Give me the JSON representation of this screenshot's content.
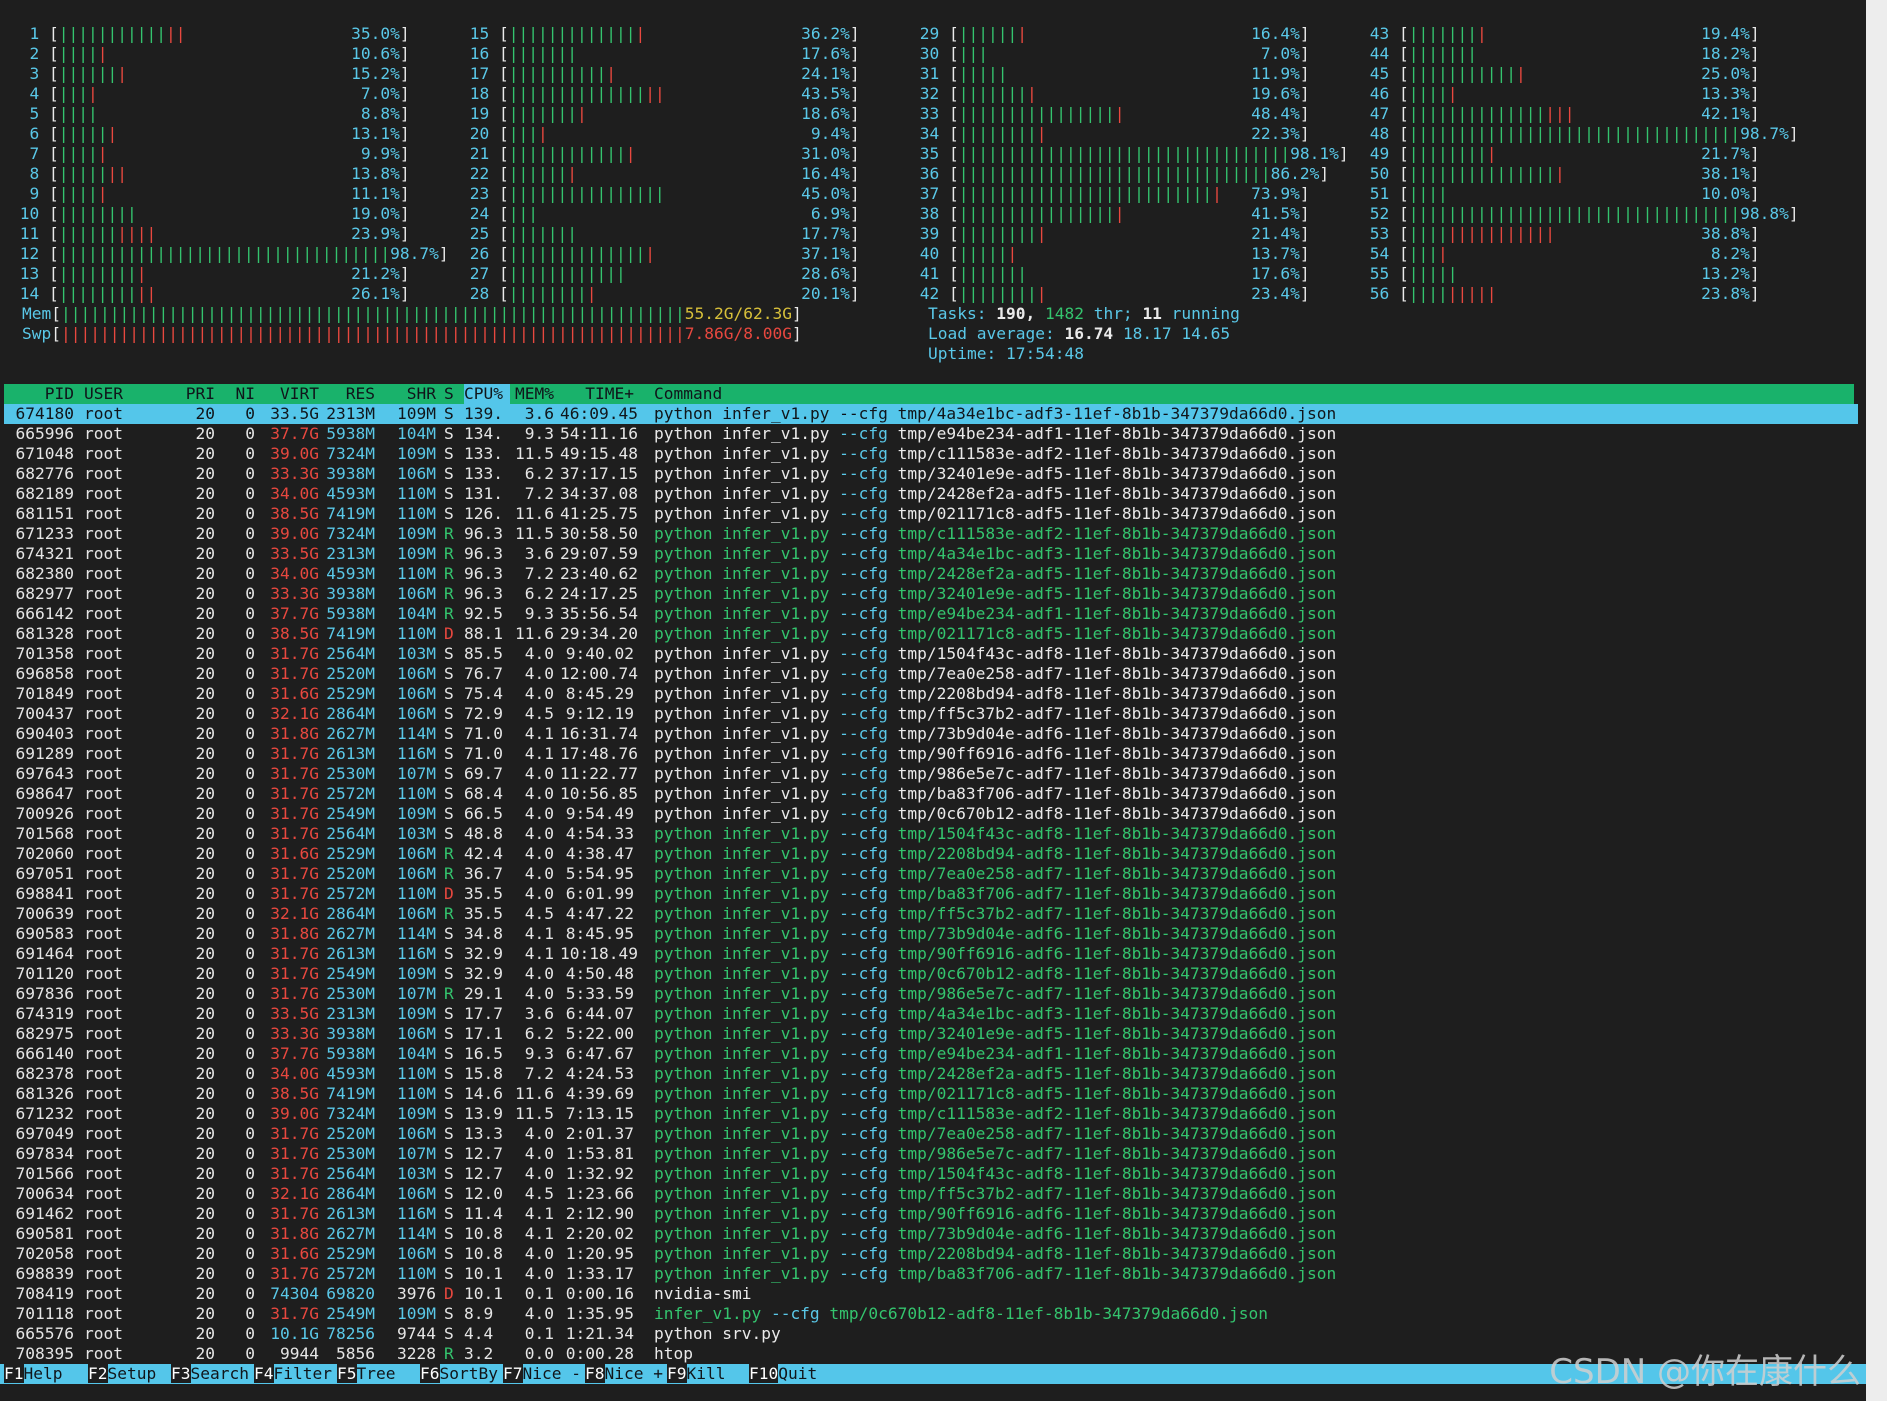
{
  "cpus": [
    {
      "id": "1",
      "pct": "35.0%",
      "g": 11,
      "r": 2
    },
    {
      "id": "2",
      "pct": "10.6%",
      "g": 4,
      "r": 1
    },
    {
      "id": "3",
      "pct": "15.2%",
      "g": 6,
      "r": 1
    },
    {
      "id": "4",
      "pct": "7.0%",
      "g": 3,
      "r": 1
    },
    {
      "id": "5",
      "pct": "8.8%",
      "g": 4,
      "r": 0
    },
    {
      "id": "6",
      "pct": "13.1%",
      "g": 5,
      "r": 1
    },
    {
      "id": "7",
      "pct": "9.9%",
      "g": 4,
      "r": 1
    },
    {
      "id": "8",
      "pct": "13.8%",
      "g": 5,
      "r": 2
    },
    {
      "id": "9",
      "pct": "11.1%",
      "g": 4,
      "r": 1
    },
    {
      "id": "10",
      "pct": "19.0%",
      "g": 8,
      "r": 0
    },
    {
      "id": "11",
      "pct": "23.9%",
      "g": 6,
      "r": 4
    },
    {
      "id": "12",
      "pct": "98.7%",
      "g": 34,
      "r": 0
    },
    {
      "id": "13",
      "pct": "21.2%",
      "g": 8,
      "r": 1
    },
    {
      "id": "14",
      "pct": "26.1%",
      "g": 8,
      "r": 2
    },
    {
      "id": "15",
      "pct": "36.2%",
      "g": 13,
      "r": 1
    },
    {
      "id": "16",
      "pct": "17.6%",
      "g": 7,
      "r": 0
    },
    {
      "id": "17",
      "pct": "24.1%",
      "g": 10,
      "r": 1
    },
    {
      "id": "18",
      "pct": "43.5%",
      "g": 14,
      "r": 2
    },
    {
      "id": "19",
      "pct": "18.6%",
      "g": 7,
      "r": 1
    },
    {
      "id": "20",
      "pct": "9.4%",
      "g": 3,
      "r": 1
    },
    {
      "id": "21",
      "pct": "31.0%",
      "g": 12,
      "r": 1
    },
    {
      "id": "22",
      "pct": "16.4%",
      "g": 6,
      "r": 1
    },
    {
      "id": "23",
      "pct": "45.0%",
      "g": 16,
      "r": 0
    },
    {
      "id": "24",
      "pct": "6.9%",
      "g": 3,
      "r": 0
    },
    {
      "id": "25",
      "pct": "17.7%",
      "g": 7,
      "r": 0
    },
    {
      "id": "26",
      "pct": "37.1%",
      "g": 14,
      "r": 1
    },
    {
      "id": "27",
      "pct": "28.6%",
      "g": 12,
      "r": 0
    },
    {
      "id": "28",
      "pct": "20.1%",
      "g": 8,
      "r": 1
    },
    {
      "id": "29",
      "pct": "16.4%",
      "g": 6,
      "r": 1
    },
    {
      "id": "30",
      "pct": "7.0%",
      "g": 3,
      "r": 0
    },
    {
      "id": "31",
      "pct": "11.9%",
      "g": 5,
      "r": 0
    },
    {
      "id": "32",
      "pct": "19.6%",
      "g": 7,
      "r": 1
    },
    {
      "id": "33",
      "pct": "48.4%",
      "g": 16,
      "r": 1
    },
    {
      "id": "34",
      "pct": "22.3%",
      "g": 8,
      "r": 1
    },
    {
      "id": "35",
      "pct": "98.1%",
      "g": 34,
      "r": 0
    },
    {
      "id": "36",
      "pct": "86.2%",
      "g": 32,
      "r": 0
    },
    {
      "id": "37",
      "pct": "73.9%",
      "g": 26,
      "r": 1
    },
    {
      "id": "38",
      "pct": "41.5%",
      "g": 16,
      "r": 1
    },
    {
      "id": "39",
      "pct": "21.4%",
      "g": 8,
      "r": 1
    },
    {
      "id": "40",
      "pct": "13.7%",
      "g": 5,
      "r": 1
    },
    {
      "id": "41",
      "pct": "17.6%",
      "g": 7,
      "r": 0
    },
    {
      "id": "42",
      "pct": "23.4%",
      "g": 8,
      "r": 1
    },
    {
      "id": "43",
      "pct": "19.4%",
      "g": 7,
      "r": 1
    },
    {
      "id": "44",
      "pct": "18.2%",
      "g": 7,
      "r": 0
    },
    {
      "id": "45",
      "pct": "25.0%",
      "g": 11,
      "r": 1
    },
    {
      "id": "46",
      "pct": "13.3%",
      "g": 4,
      "r": 1
    },
    {
      "id": "47",
      "pct": "42.1%",
      "g": 14,
      "r": 3
    },
    {
      "id": "48",
      "pct": "98.7%",
      "g": 34,
      "r": 0
    },
    {
      "id": "49",
      "pct": "21.7%",
      "g": 8,
      "r": 1
    },
    {
      "id": "50",
      "pct": "38.1%",
      "g": 15,
      "r": 1
    },
    {
      "id": "51",
      "pct": "10.0%",
      "g": 4,
      "r": 0
    },
    {
      "id": "52",
      "pct": "98.8%",
      "g": 34,
      "r": 0
    },
    {
      "id": "53",
      "pct": "38.8%",
      "g": 4,
      "r": 11
    },
    {
      "id": "54",
      "pct": "8.2%",
      "g": 3,
      "r": 1
    },
    {
      "id": "55",
      "pct": "13.2%",
      "g": 5,
      "r": 0
    },
    {
      "id": "56",
      "pct": "23.8%",
      "g": 4,
      "r": 5
    }
  ],
  "mem": {
    "label": "Mem",
    "value": "55.2G/62.3G"
  },
  "swp": {
    "label": "Swp",
    "value": "7.86G/8.00G"
  },
  "tasks": {
    "label": "Tasks:",
    "count": "190,",
    "thr": "1482",
    "thr_label": "thr;",
    "running": "11",
    "running_label": "running"
  },
  "load": {
    "label": "Load average:",
    "l1": "16.74",
    "l5": "18.17",
    "l15": "14.65"
  },
  "uptime": {
    "label": "Uptime:",
    "value": "17:54:48"
  },
  "columns": [
    "PID",
    "USER",
    "PRI",
    "NI",
    "VIRT",
    "RES",
    "SHR",
    "S",
    "CPU%",
    "MEM%",
    "TIME+",
    "Command"
  ],
  "processes": [
    [
      "674180",
      "root",
      "20",
      "0",
      "33.5G",
      "2313M",
      "109M",
      "S",
      "139.",
      "3.6",
      "46:09.45",
      "python",
      "infer_v1.py",
      "--cfg",
      "tmp/4a34e1bc-adf3-11ef-8b1b-347379da66d0.json",
      "w"
    ],
    [
      "665996",
      "root",
      "20",
      "0",
      "37.7G",
      "5938M",
      "104M",
      "S",
      "134.",
      "9.3",
      "54:11.16",
      "python",
      "infer_v1.py",
      "--cfg",
      "tmp/e94be234-adf1-11ef-8b1b-347379da66d0.json",
      "w"
    ],
    [
      "671048",
      "root",
      "20",
      "0",
      "39.0G",
      "7324M",
      "109M",
      "S",
      "133.",
      "11.5",
      "49:15.48",
      "python",
      "infer_v1.py",
      "--cfg",
      "tmp/c111583e-adf2-11ef-8b1b-347379da66d0.json",
      "w"
    ],
    [
      "682776",
      "root",
      "20",
      "0",
      "33.3G",
      "3938M",
      "106M",
      "S",
      "133.",
      "6.2",
      "37:17.15",
      "python",
      "infer_v1.py",
      "--cfg",
      "tmp/32401e9e-adf5-11ef-8b1b-347379da66d0.json",
      "w"
    ],
    [
      "682189",
      "root",
      "20",
      "0",
      "34.0G",
      "4593M",
      "110M",
      "S",
      "131.",
      "7.2",
      "34:37.08",
      "python",
      "infer_v1.py",
      "--cfg",
      "tmp/2428ef2a-adf5-11ef-8b1b-347379da66d0.json",
      "w"
    ],
    [
      "681151",
      "root",
      "20",
      "0",
      "38.5G",
      "7419M",
      "110M",
      "S",
      "126.",
      "11.6",
      "41:25.75",
      "python",
      "infer_v1.py",
      "--cfg",
      "tmp/021171c8-adf5-11ef-8b1b-347379da66d0.json",
      "w"
    ],
    [
      "671233",
      "root",
      "20",
      "0",
      "39.0G",
      "7324M",
      "109M",
      "R",
      "96.3",
      "11.5",
      "30:58.50",
      "python",
      "infer_v1.py",
      "--cfg",
      "tmp/c111583e-adf2-11ef-8b1b-347379da66d0.json",
      "g"
    ],
    [
      "674321",
      "root",
      "20",
      "0",
      "33.5G",
      "2313M",
      "109M",
      "R",
      "96.3",
      "3.6",
      "29:07.59",
      "python",
      "infer_v1.py",
      "--cfg",
      "tmp/4a34e1bc-adf3-11ef-8b1b-347379da66d0.json",
      "g"
    ],
    [
      "682380",
      "root",
      "20",
      "0",
      "34.0G",
      "4593M",
      "110M",
      "R",
      "96.3",
      "7.2",
      "23:40.62",
      "python",
      "infer_v1.py",
      "--cfg",
      "tmp/2428ef2a-adf5-11ef-8b1b-347379da66d0.json",
      "g"
    ],
    [
      "682977",
      "root",
      "20",
      "0",
      "33.3G",
      "3938M",
      "106M",
      "R",
      "96.3",
      "6.2",
      "24:17.25",
      "python",
      "infer_v1.py",
      "--cfg",
      "tmp/32401e9e-adf5-11ef-8b1b-347379da66d0.json",
      "g"
    ],
    [
      "666142",
      "root",
      "20",
      "0",
      "37.7G",
      "5938M",
      "104M",
      "R",
      "92.5",
      "9.3",
      "35:56.54",
      "python",
      "infer_v1.py",
      "--cfg",
      "tmp/e94be234-adf1-11ef-8b1b-347379da66d0.json",
      "g"
    ],
    [
      "681328",
      "root",
      "20",
      "0",
      "38.5G",
      "7419M",
      "110M",
      "D",
      "88.1",
      "11.6",
      "29:34.20",
      "python",
      "infer_v1.py",
      "--cfg",
      "tmp/021171c8-adf5-11ef-8b1b-347379da66d0.json",
      "g"
    ],
    [
      "701358",
      "root",
      "20",
      "0",
      "31.7G",
      "2564M",
      "103M",
      "S",
      "85.5",
      "4.0",
      "9:40.02",
      "python",
      "infer_v1.py",
      "--cfg",
      "tmp/1504f43c-adf8-11ef-8b1b-347379da66d0.json",
      "w"
    ],
    [
      "696858",
      "root",
      "20",
      "0",
      "31.7G",
      "2520M",
      "106M",
      "S",
      "76.7",
      "4.0",
      "12:00.74",
      "python",
      "infer_v1.py",
      "--cfg",
      "tmp/7ea0e258-adf7-11ef-8b1b-347379da66d0.json",
      "w"
    ],
    [
      "701849",
      "root",
      "20",
      "0",
      "31.6G",
      "2529M",
      "106M",
      "S",
      "75.4",
      "4.0",
      "8:45.29",
      "python",
      "infer_v1.py",
      "--cfg",
      "tmp/2208bd94-adf8-11ef-8b1b-347379da66d0.json",
      "w"
    ],
    [
      "700437",
      "root",
      "20",
      "0",
      "32.1G",
      "2864M",
      "106M",
      "S",
      "72.9",
      "4.5",
      "9:12.19",
      "python",
      "infer_v1.py",
      "--cfg",
      "tmp/ff5c37b2-adf7-11ef-8b1b-347379da66d0.json",
      "w"
    ],
    [
      "690403",
      "root",
      "20",
      "0",
      "31.8G",
      "2627M",
      "114M",
      "S",
      "71.0",
      "4.1",
      "16:31.74",
      "python",
      "infer_v1.py",
      "--cfg",
      "tmp/73b9d04e-adf6-11ef-8b1b-347379da66d0.json",
      "w"
    ],
    [
      "691289",
      "root",
      "20",
      "0",
      "31.7G",
      "2613M",
      "116M",
      "S",
      "71.0",
      "4.1",
      "17:48.76",
      "python",
      "infer_v1.py",
      "--cfg",
      "tmp/90ff6916-adf6-11ef-8b1b-347379da66d0.json",
      "w"
    ],
    [
      "697643",
      "root",
      "20",
      "0",
      "31.7G",
      "2530M",
      "107M",
      "S",
      "69.7",
      "4.0",
      "11:22.77",
      "python",
      "infer_v1.py",
      "--cfg",
      "tmp/986e5e7c-adf7-11ef-8b1b-347379da66d0.json",
      "w"
    ],
    [
      "698647",
      "root",
      "20",
      "0",
      "31.7G",
      "2572M",
      "110M",
      "S",
      "68.4",
      "4.0",
      "10:56.85",
      "python",
      "infer_v1.py",
      "--cfg",
      "tmp/ba83f706-adf7-11ef-8b1b-347379da66d0.json",
      "w"
    ],
    [
      "700926",
      "root",
      "20",
      "0",
      "31.7G",
      "2549M",
      "109M",
      "S",
      "66.5",
      "4.0",
      "9:54.49",
      "python",
      "infer_v1.py",
      "--cfg",
      "tmp/0c670b12-adf8-11ef-8b1b-347379da66d0.json",
      "w"
    ],
    [
      "701568",
      "root",
      "20",
      "0",
      "31.7G",
      "2564M",
      "103M",
      "S",
      "48.8",
      "4.0",
      "4:54.33",
      "python",
      "infer_v1.py",
      "--cfg",
      "tmp/1504f43c-adf8-11ef-8b1b-347379da66d0.json",
      "g"
    ],
    [
      "702060",
      "root",
      "20",
      "0",
      "31.6G",
      "2529M",
      "106M",
      "R",
      "42.4",
      "4.0",
      "4:38.47",
      "python",
      "infer_v1.py",
      "--cfg",
      "tmp/2208bd94-adf8-11ef-8b1b-347379da66d0.json",
      "g"
    ],
    [
      "697051",
      "root",
      "20",
      "0",
      "31.7G",
      "2520M",
      "106M",
      "R",
      "36.7",
      "4.0",
      "5:54.95",
      "python",
      "infer_v1.py",
      "--cfg",
      "tmp/7ea0e258-adf7-11ef-8b1b-347379da66d0.json",
      "g"
    ],
    [
      "698841",
      "root",
      "20",
      "0",
      "31.7G",
      "2572M",
      "110M",
      "D",
      "35.5",
      "4.0",
      "6:01.99",
      "python",
      "infer_v1.py",
      "--cfg",
      "tmp/ba83f706-adf7-11ef-8b1b-347379da66d0.json",
      "g"
    ],
    [
      "700639",
      "root",
      "20",
      "0",
      "32.1G",
      "2864M",
      "106M",
      "R",
      "35.5",
      "4.5",
      "4:47.22",
      "python",
      "infer_v1.py",
      "--cfg",
      "tmp/ff5c37b2-adf7-11ef-8b1b-347379da66d0.json",
      "g"
    ],
    [
      "690583",
      "root",
      "20",
      "0",
      "31.8G",
      "2627M",
      "114M",
      "S",
      "34.8",
      "4.1",
      "8:45.95",
      "python",
      "infer_v1.py",
      "--cfg",
      "tmp/73b9d04e-adf6-11ef-8b1b-347379da66d0.json",
      "g"
    ],
    [
      "691464",
      "root",
      "20",
      "0",
      "31.7G",
      "2613M",
      "116M",
      "S",
      "32.9",
      "4.1",
      "10:18.49",
      "python",
      "infer_v1.py",
      "--cfg",
      "tmp/90ff6916-adf6-11ef-8b1b-347379da66d0.json",
      "g"
    ],
    [
      "701120",
      "root",
      "20",
      "0",
      "31.7G",
      "2549M",
      "109M",
      "S",
      "32.9",
      "4.0",
      "4:50.48",
      "python",
      "infer_v1.py",
      "--cfg",
      "tmp/0c670b12-adf8-11ef-8b1b-347379da66d0.json",
      "g"
    ],
    [
      "697836",
      "root",
      "20",
      "0",
      "31.7G",
      "2530M",
      "107M",
      "R",
      "29.1",
      "4.0",
      "5:33.59",
      "python",
      "infer_v1.py",
      "--cfg",
      "tmp/986e5e7c-adf7-11ef-8b1b-347379da66d0.json",
      "g"
    ],
    [
      "674319",
      "root",
      "20",
      "0",
      "33.5G",
      "2313M",
      "109M",
      "S",
      "17.7",
      "3.6",
      "6:44.07",
      "python",
      "infer_v1.py",
      "--cfg",
      "tmp/4a34e1bc-adf3-11ef-8b1b-347379da66d0.json",
      "g"
    ],
    [
      "682975",
      "root",
      "20",
      "0",
      "33.3G",
      "3938M",
      "106M",
      "S",
      "17.1",
      "6.2",
      "5:22.00",
      "python",
      "infer_v1.py",
      "--cfg",
      "tmp/32401e9e-adf5-11ef-8b1b-347379da66d0.json",
      "g"
    ],
    [
      "666140",
      "root",
      "20",
      "0",
      "37.7G",
      "5938M",
      "104M",
      "S",
      "16.5",
      "9.3",
      "6:47.67",
      "python",
      "infer_v1.py",
      "--cfg",
      "tmp/e94be234-adf1-11ef-8b1b-347379da66d0.json",
      "g"
    ],
    [
      "682378",
      "root",
      "20",
      "0",
      "34.0G",
      "4593M",
      "110M",
      "S",
      "15.8",
      "7.2",
      "4:24.53",
      "python",
      "infer_v1.py",
      "--cfg",
      "tmp/2428ef2a-adf5-11ef-8b1b-347379da66d0.json",
      "g"
    ],
    [
      "681326",
      "root",
      "20",
      "0",
      "38.5G",
      "7419M",
      "110M",
      "S",
      "14.6",
      "11.6",
      "4:39.69",
      "python",
      "infer_v1.py",
      "--cfg",
      "tmp/021171c8-adf5-11ef-8b1b-347379da66d0.json",
      "g"
    ],
    [
      "671232",
      "root",
      "20",
      "0",
      "39.0G",
      "7324M",
      "109M",
      "S",
      "13.9",
      "11.5",
      "7:13.15",
      "python",
      "infer_v1.py",
      "--cfg",
      "tmp/c111583e-adf2-11ef-8b1b-347379da66d0.json",
      "g"
    ],
    [
      "697049",
      "root",
      "20",
      "0",
      "31.7G",
      "2520M",
      "106M",
      "S",
      "13.3",
      "4.0",
      "2:01.37",
      "python",
      "infer_v1.py",
      "--cfg",
      "tmp/7ea0e258-adf7-11ef-8b1b-347379da66d0.json",
      "g"
    ],
    [
      "697834",
      "root",
      "20",
      "0",
      "31.7G",
      "2530M",
      "107M",
      "S",
      "12.7",
      "4.0",
      "1:53.81",
      "python",
      "infer_v1.py",
      "--cfg",
      "tmp/986e5e7c-adf7-11ef-8b1b-347379da66d0.json",
      "g"
    ],
    [
      "701566",
      "root",
      "20",
      "0",
      "31.7G",
      "2564M",
      "103M",
      "S",
      "12.7",
      "4.0",
      "1:32.92",
      "python",
      "infer_v1.py",
      "--cfg",
      "tmp/1504f43c-adf8-11ef-8b1b-347379da66d0.json",
      "g"
    ],
    [
      "700634",
      "root",
      "20",
      "0",
      "32.1G",
      "2864M",
      "106M",
      "S",
      "12.0",
      "4.5",
      "1:23.66",
      "python",
      "infer_v1.py",
      "--cfg",
      "tmp/ff5c37b2-adf7-11ef-8b1b-347379da66d0.json",
      "g"
    ],
    [
      "691462",
      "root",
      "20",
      "0",
      "31.7G",
      "2613M",
      "116M",
      "S",
      "11.4",
      "4.1",
      "2:12.90",
      "python",
      "infer_v1.py",
      "--cfg",
      "tmp/90ff6916-adf6-11ef-8b1b-347379da66d0.json",
      "g"
    ],
    [
      "690581",
      "root",
      "20",
      "0",
      "31.8G",
      "2627M",
      "114M",
      "S",
      "10.8",
      "4.1",
      "2:20.02",
      "python",
      "infer_v1.py",
      "--cfg",
      "tmp/73b9d04e-adf6-11ef-8b1b-347379da66d0.json",
      "g"
    ],
    [
      "702058",
      "root",
      "20",
      "0",
      "31.6G",
      "2529M",
      "106M",
      "S",
      "10.8",
      "4.0",
      "1:20.95",
      "python",
      "infer_v1.py",
      "--cfg",
      "tmp/2208bd94-adf8-11ef-8b1b-347379da66d0.json",
      "g"
    ],
    [
      "698839",
      "root",
      "20",
      "0",
      "31.7G",
      "2572M",
      "110M",
      "S",
      "10.1",
      "4.0",
      "1:33.17",
      "python",
      "infer_v1.py",
      "--cfg",
      "tmp/ba83f706-adf7-11ef-8b1b-347379da66d0.json",
      "g"
    ],
    [
      "708419",
      "root",
      "20",
      "0",
      "74304",
      "69820",
      "3976",
      "D",
      "10.1",
      "0.1",
      "0:00.16",
      "nvidia-smi",
      "",
      "",
      "",
      "w"
    ],
    [
      "701118",
      "root",
      "20",
      "0",
      "31.7G",
      "2549M",
      "109M",
      "S",
      "8.9",
      "4.0",
      "1:35.95",
      "",
      "infer_v1.py",
      "--cfg",
      "tmp/0c670b12-adf8-11ef-8b1b-347379da66d0.json",
      "g"
    ],
    [
      "665576",
      "root",
      "20",
      "0",
      "10.1G",
      "78256",
      "9744",
      "S",
      "4.4",
      "0.1",
      "1:21.34",
      "python",
      "srv.py",
      "",
      "",
      "w"
    ],
    [
      "708395",
      "root",
      "20",
      "0",
      "9944",
      "5856",
      "3228",
      "R",
      "3.2",
      "0.0",
      "0:00.28",
      "htop",
      "",
      "",
      "",
      "w"
    ]
  ],
  "footer": [
    {
      "key": "F1",
      "label": "Help"
    },
    {
      "key": "F2",
      "label": "Setup"
    },
    {
      "key": "F3",
      "label": "Search"
    },
    {
      "key": "F4",
      "label": "Filter"
    },
    {
      "key": "F5",
      "label": "Tree"
    },
    {
      "key": "F6",
      "label": "SortBy"
    },
    {
      "key": "F7",
      "label": "Nice -"
    },
    {
      "key": "F8",
      "label": "Nice +"
    },
    {
      "key": "F9",
      "label": "Kill"
    },
    {
      "key": "F10",
      "label": "Quit"
    }
  ],
  "watermark": "CSDN @你在康什么",
  "colors": {
    "bg": "#1e1e1e",
    "cyan": "#5ac8e8",
    "green": "#34c46e",
    "red": "#e8483f",
    "header_bg": "#19b26b",
    "selected_bg": "#54c6ea"
  }
}
